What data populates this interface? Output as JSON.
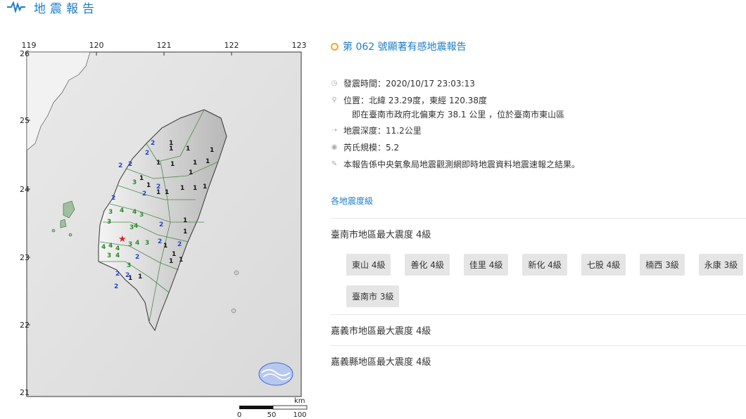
{
  "header": {
    "title": "地震報告",
    "icon": "seismic-wave-icon",
    "accent": "#1e7ec8"
  },
  "map": {
    "lon_ticks": [
      "119",
      "120",
      "121",
      "122",
      "123"
    ],
    "lat_ticks": [
      "26",
      "25",
      "24",
      "23",
      "22",
      "21"
    ],
    "scale_unit": "km",
    "scale_labels": [
      "0",
      "50",
      "100"
    ],
    "epicenter_icon": "star-icon",
    "intensity_labels": {
      "blue": [
        "2",
        "2",
        "2",
        "2",
        "2",
        "2",
        "2",
        "2",
        "2",
        "2",
        "2",
        "2",
        "2",
        "2"
      ],
      "black": [
        "1",
        "1",
        "1",
        "1",
        "1",
        "1",
        "1",
        "1",
        "1",
        "1",
        "1",
        "1",
        "1",
        "1",
        "1",
        "1",
        "1",
        "1",
        "1",
        "1",
        "1",
        "1",
        "1",
        "1"
      ],
      "green": [
        "3",
        "3",
        "3",
        "4",
        "4",
        "3",
        "3",
        "4",
        "4",
        "4",
        "4",
        "3",
        "4",
        "4",
        "3",
        "3",
        "3"
      ]
    }
  },
  "report": {
    "title": "第 062 號顯著有感地震報告",
    "time": "發震時間：2020/10/17 23:03:13",
    "location": "位置：北緯 23.29度，東經 120.38度",
    "location_detail": "即在臺南市政府北偏東方 38.1 公里 ，位於臺南市東山區",
    "depth": "地震深度：11.2公里",
    "magnitude": "芮氏規模：5.2",
    "note": "本報告係中央氣象局地震觀測網即時地震資料地震速報之結果。",
    "levels_link": "各地震度級"
  },
  "regions": [
    {
      "title": "臺南市地區最大震度 4級",
      "stations": [
        "東山 4級",
        "善化 4級",
        "佳里 4級",
        "新化 4級",
        "七股 4級",
        "楠西 3級",
        "永康 3級",
        "臺南市 3級"
      ]
    },
    {
      "title": "嘉義市地區最大震度 4級"
    },
    {
      "title": "嘉義縣地區最大震度 4級"
    }
  ]
}
